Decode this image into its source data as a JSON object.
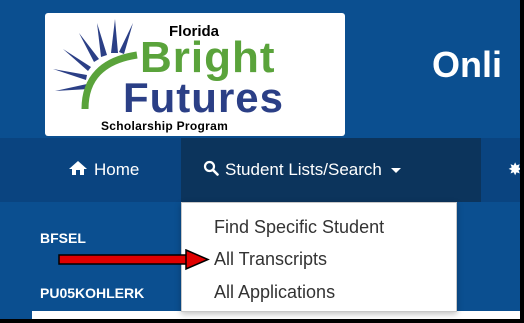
{
  "logo": {
    "line_1": "Florida",
    "line_2": "Bright",
    "line_3": "Futures",
    "line_4": "Scholarship Program"
  },
  "header": {
    "title": "Onli"
  },
  "nav": {
    "home_label": "Home",
    "search_label": "Student Lists/Search",
    "more_glyph": "✸"
  },
  "sidebar": {
    "label_1": "BFSEL",
    "label_2": "PU05KOHLERK"
  },
  "dropdown": {
    "items": [
      "Find Specific Student",
      "All Transcripts",
      "All Applications"
    ]
  },
  "colors": {
    "header_blue": "#0b4f90",
    "nav_blue": "#0a4480",
    "nav_active": "#0c345c",
    "brand_green": "#5aa33b",
    "brand_navy": "#2b3f86",
    "annotation_red": "#e00000"
  }
}
